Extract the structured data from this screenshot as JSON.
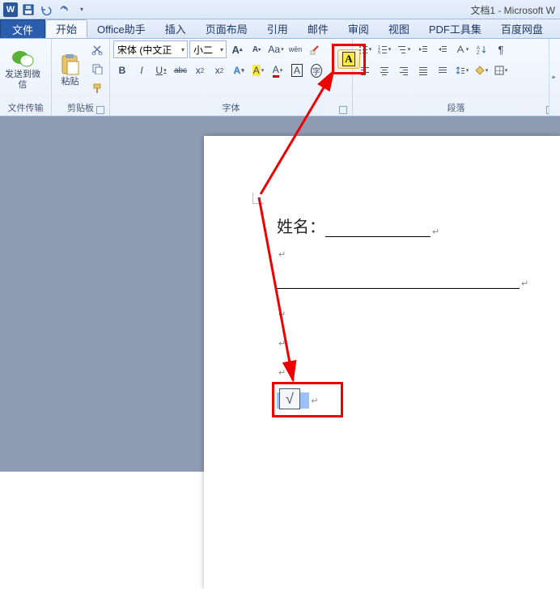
{
  "title": "文档1 - Microsoft W",
  "qat": {
    "app": "W"
  },
  "tabs": {
    "file": "文件",
    "items": [
      "开始",
      "Office助手",
      "插入",
      "页面布局",
      "引用",
      "邮件",
      "审阅",
      "视图",
      "PDF工具集",
      "百度网盘"
    ],
    "activeIndex": 0
  },
  "groups": {
    "wechat": {
      "label": "发送到微信",
      "section": "文件传输"
    },
    "clipboard": {
      "paste": "粘贴",
      "section": "剪贴板"
    },
    "font": {
      "section": "字体",
      "name": "宋体 (中文正",
      "size": "小二",
      "buttons": {
        "grow": "A",
        "shrink": "A",
        "changecase": "Aa",
        "bold": "B",
        "italic": "I",
        "underline": "U",
        "strike": "abc",
        "sub": "x",
        "sup": "x",
        "wordart": "A",
        "highlight": "A",
        "fontcolor": "A",
        "phonetic": "wēn",
        "charborder": "A",
        "circled": "字"
      }
    },
    "paragraph": {
      "section": "段落"
    }
  },
  "document": {
    "line1_label": "姓名：",
    "checkbox_symbol": "√"
  }
}
